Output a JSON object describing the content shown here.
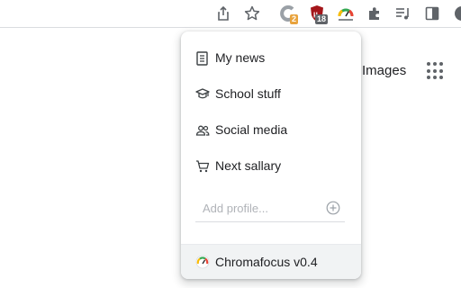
{
  "toolbar": {
    "icons": [
      {
        "name": "share-icon"
      },
      {
        "name": "bookmark-star-icon"
      },
      {
        "name": "extension-c-icon",
        "badge": "2",
        "badge_color": "#e8a33d"
      },
      {
        "name": "ublock-icon",
        "badge": "18",
        "badge_color": "#5f6368"
      },
      {
        "name": "chromafocus-icon"
      },
      {
        "name": "puzzle-extensions-icon"
      },
      {
        "name": "media-control-icon"
      },
      {
        "name": "side-panel-icon"
      },
      {
        "name": "profile-avatar-icon"
      }
    ]
  },
  "page": {
    "images_link": "Images",
    "apps_icon": "apps-grid-icon"
  },
  "popup": {
    "items": [
      {
        "label": "My news",
        "icon": "newspaper-icon"
      },
      {
        "label": "School stuff",
        "icon": "graduation-cap-icon"
      },
      {
        "label": "Social media",
        "icon": "people-icon"
      },
      {
        "label": "Next sallary",
        "icon": "shopping-cart-icon"
      }
    ],
    "add_profile": {
      "placeholder": "Add profile...",
      "value": "",
      "add_icon": "plus-circle-icon"
    },
    "footer": {
      "label": "Chromafocus v0.4",
      "icon": "chromafocus-logo-icon"
    }
  },
  "colors": {
    "accent_badge_orange": "#e8a33d",
    "ublock_red": "#a4161a",
    "footer_bg": "#f1f3f4"
  }
}
